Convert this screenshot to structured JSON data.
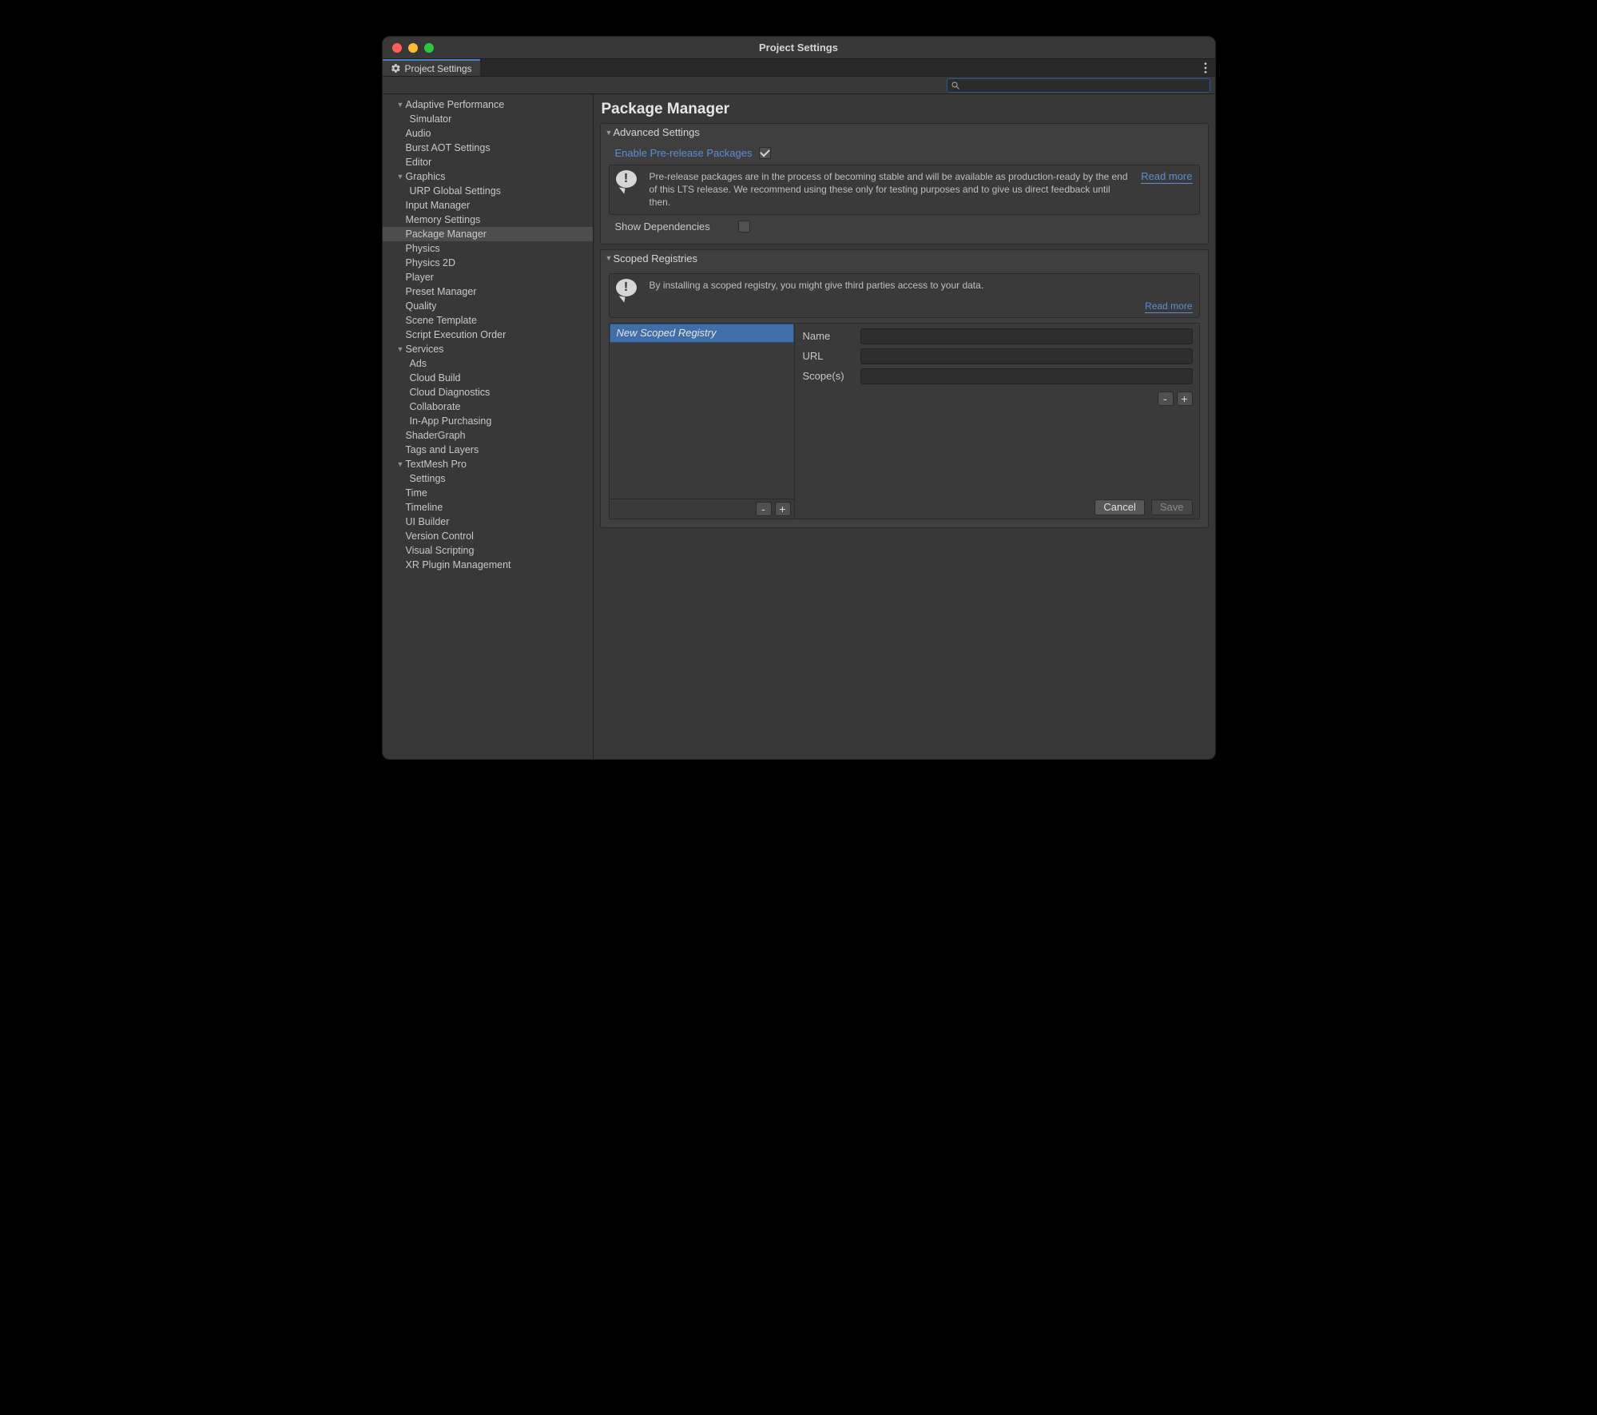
{
  "window_title": "Project Settings",
  "tab_label": "Project Settings",
  "search_placeholder": "",
  "sidebar": [
    {
      "label": "Adaptive Performance",
      "level": 1,
      "expandable": true
    },
    {
      "label": "Simulator",
      "level": 2
    },
    {
      "label": "Audio",
      "level": 1
    },
    {
      "label": "Burst AOT Settings",
      "level": 1
    },
    {
      "label": "Editor",
      "level": 1
    },
    {
      "label": "Graphics",
      "level": 1,
      "expandable": true
    },
    {
      "label": "URP Global Settings",
      "level": 2
    },
    {
      "label": "Input Manager",
      "level": 1
    },
    {
      "label": "Memory Settings",
      "level": 1
    },
    {
      "label": "Package Manager",
      "level": 1,
      "selected": true
    },
    {
      "label": "Physics",
      "level": 1
    },
    {
      "label": "Physics 2D",
      "level": 1
    },
    {
      "label": "Player",
      "level": 1
    },
    {
      "label": "Preset Manager",
      "level": 1
    },
    {
      "label": "Quality",
      "level": 1
    },
    {
      "label": "Scene Template",
      "level": 1
    },
    {
      "label": "Script Execution Order",
      "level": 1
    },
    {
      "label": "Services",
      "level": 1,
      "expandable": true
    },
    {
      "label": "Ads",
      "level": 2
    },
    {
      "label": "Cloud Build",
      "level": 2
    },
    {
      "label": "Cloud Diagnostics",
      "level": 2
    },
    {
      "label": "Collaborate",
      "level": 2
    },
    {
      "label": "In-App Purchasing",
      "level": 2
    },
    {
      "label": "ShaderGraph",
      "level": 1
    },
    {
      "label": "Tags and Layers",
      "level": 1
    },
    {
      "label": "TextMesh Pro",
      "level": 1,
      "expandable": true
    },
    {
      "label": "Settings",
      "level": 2
    },
    {
      "label": "Time",
      "level": 1
    },
    {
      "label": "Timeline",
      "level": 1
    },
    {
      "label": "UI Builder",
      "level": 1
    },
    {
      "label": "Version Control",
      "level": 1
    },
    {
      "label": "Visual Scripting",
      "level": 1
    },
    {
      "label": "XR Plugin Management",
      "level": 1
    }
  ],
  "page": {
    "title": "Package Manager",
    "advanced": {
      "header": "Advanced Settings",
      "enable_prerelease_label": "Enable Pre-release Packages",
      "enable_prerelease_checked": true,
      "info": "Pre-release packages are in the process of becoming stable and will be available as production-ready by the end of this LTS release. We recommend using these only for testing purposes and to give us direct feedback until then.",
      "read_more": "Read more",
      "show_deps_label": "Show Dependencies",
      "show_deps_checked": false
    },
    "scoped": {
      "header": "Scoped Registries",
      "info": "By installing a scoped registry, you might give third parties access to your data.",
      "read_more": "Read more",
      "list": [
        {
          "name": "New Scoped Registry",
          "selected": true
        }
      ],
      "fields": {
        "name_label": "Name",
        "name_value": "",
        "url_label": "URL",
        "url_value": "",
        "scopes_label": "Scope(s)",
        "scopes_value": ""
      },
      "remove_label": "-",
      "add_label": "+",
      "cancel_label": "Cancel",
      "save_label": "Save"
    }
  }
}
